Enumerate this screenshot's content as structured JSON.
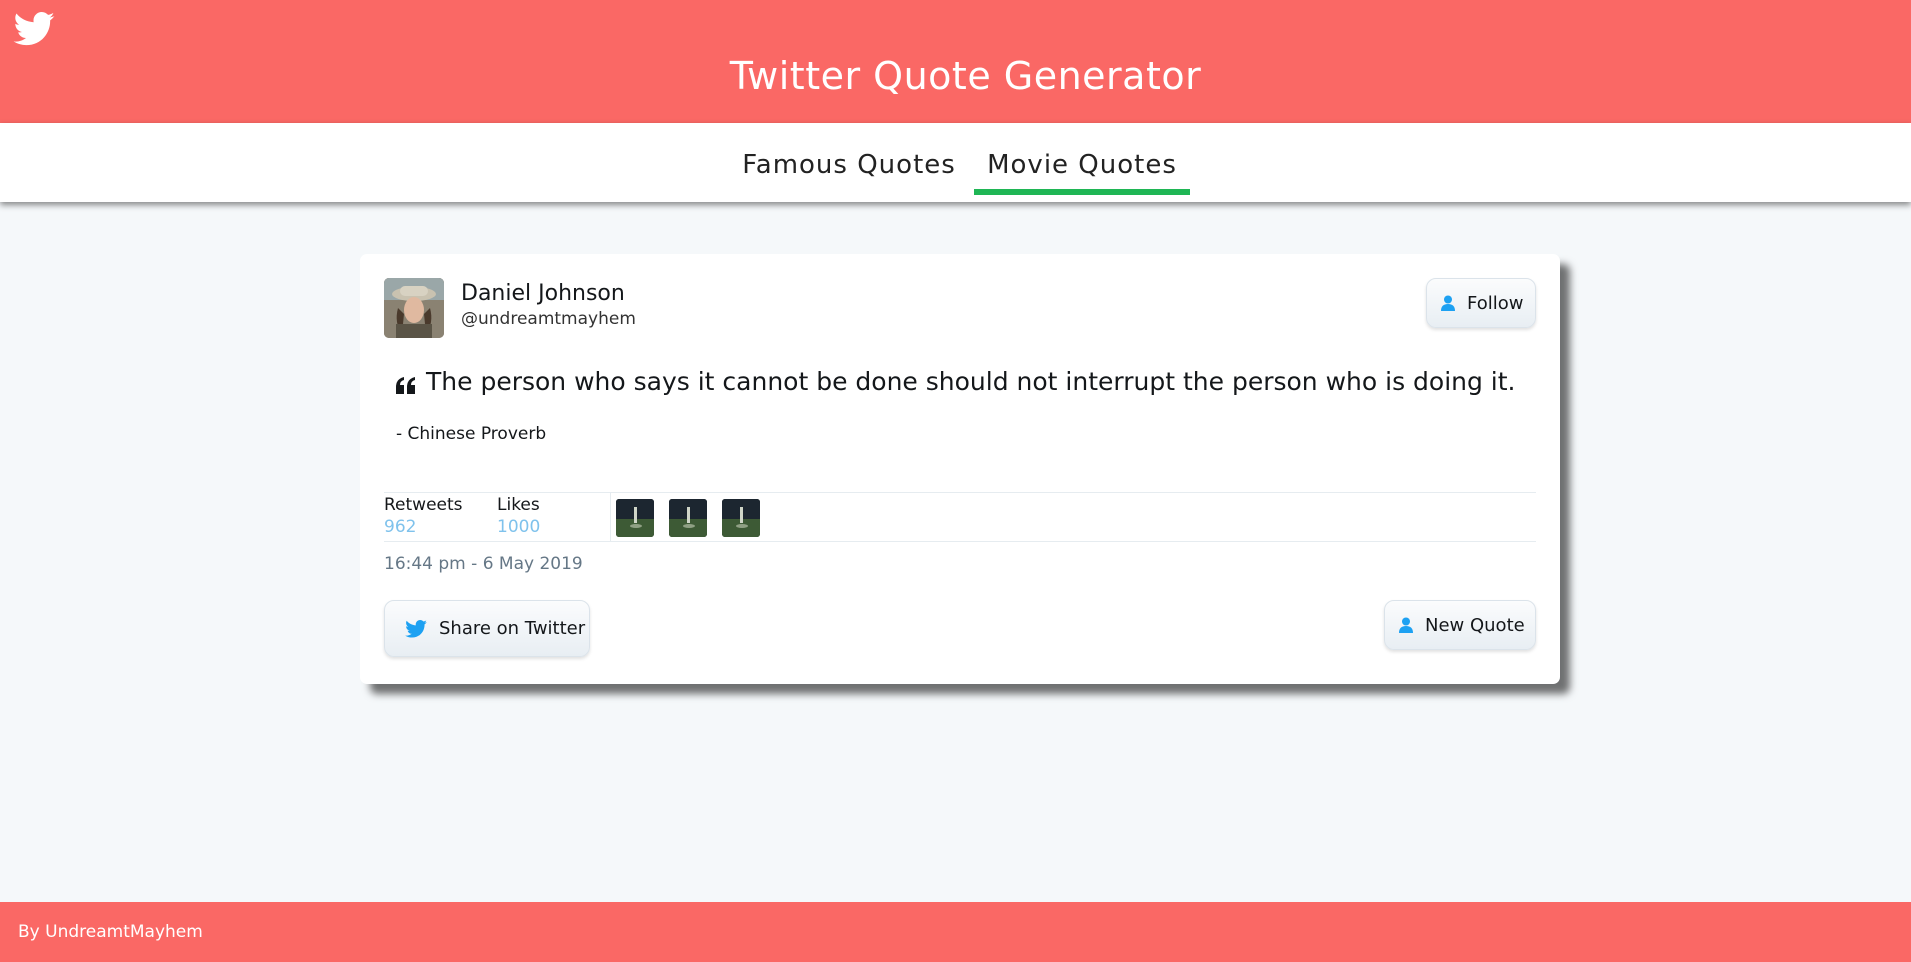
{
  "header": {
    "title": "Twitter Quote Generator",
    "logo_icon": "twitter-bird-icon",
    "color": "#fa6865"
  },
  "nav": {
    "tabs": [
      {
        "label": "Famous Quotes",
        "active": false
      },
      {
        "label": "Movie Quotes",
        "active": true
      }
    ],
    "active_color": "#1fb655"
  },
  "card": {
    "user": {
      "name": "Daniel Johnson",
      "handle": "@undreamtmayhem"
    },
    "follow_label": "Follow",
    "quote": {
      "text": "The person who says it cannot be done should not interrupt the person who is doing it.",
      "author": "- Chinese Proverb"
    },
    "stats": {
      "retweets_label": "Retweets",
      "retweets_value": "962",
      "likes_label": "Likes",
      "likes_value": "1000"
    },
    "timestamp": "16:44 pm - 6 May 2019",
    "share_label": "Share on Twitter",
    "new_quote_label": "New Quote"
  },
  "footer": {
    "text": "By UndreamtMayhem"
  }
}
